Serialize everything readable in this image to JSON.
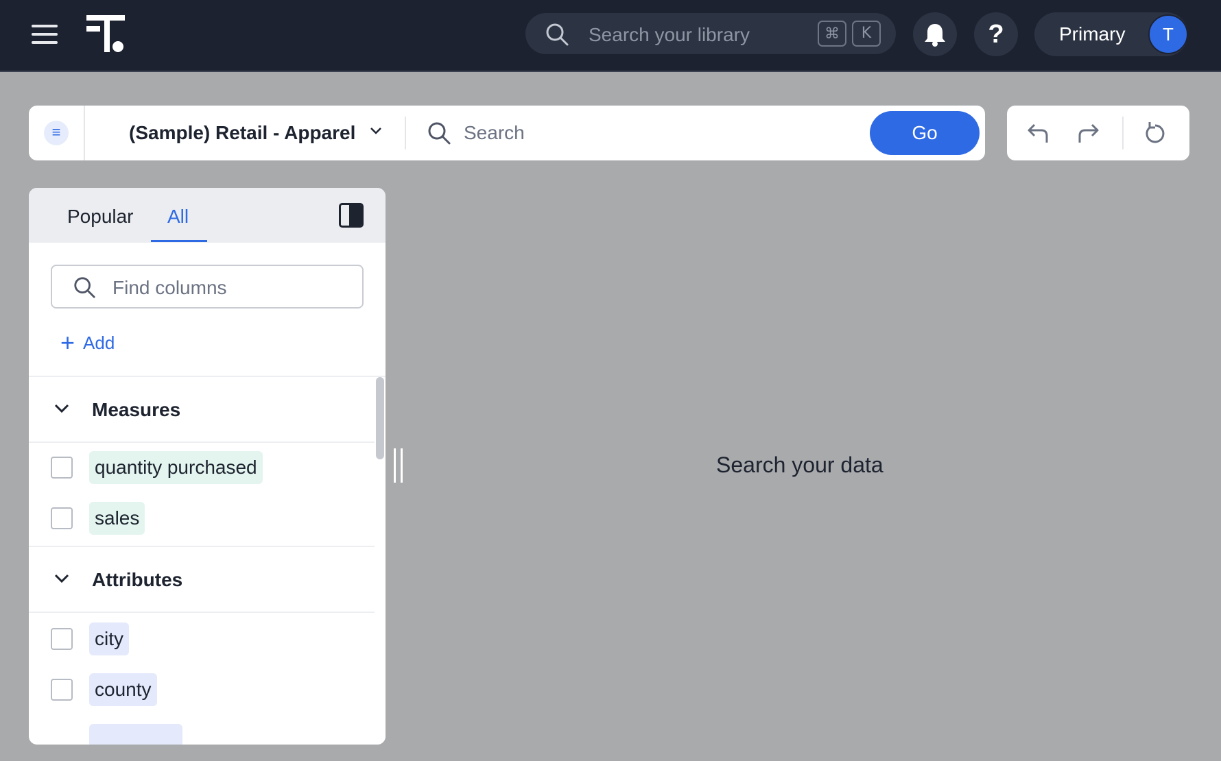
{
  "topbar": {
    "library_search_placeholder": "Search your library",
    "shortcut_cmd": "⌘",
    "shortcut_key": "K",
    "help_label": "?",
    "org_label": "Primary",
    "avatar_initial": "T"
  },
  "searchbar": {
    "source_name": "(Sample) Retail - Apparel",
    "search_placeholder": "Search",
    "go_label": "Go"
  },
  "panel": {
    "tabs": [
      {
        "label": "Popular",
        "active": false
      },
      {
        "label": "All",
        "active": true
      }
    ],
    "find_placeholder": "Find columns",
    "add_label": "Add",
    "sections": [
      {
        "title": "Measures",
        "columns": [
          "quantity purchased",
          "sales"
        ]
      },
      {
        "title": "Attributes",
        "columns": [
          "city",
          "county"
        ]
      }
    ]
  },
  "main": {
    "empty_message": "Search your data"
  },
  "colors": {
    "accent": "#2f6ae5",
    "topbar_bg": "#1d2230",
    "canvas_bg": "#a9aaac",
    "measure_chip": "#e3f5ee",
    "attribute_chip": "#e4e9fb"
  }
}
